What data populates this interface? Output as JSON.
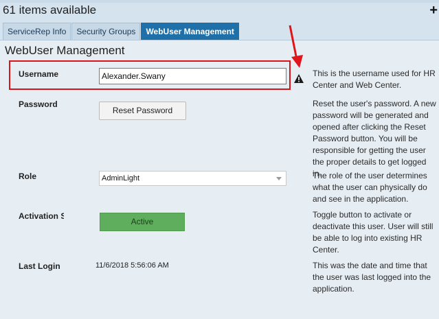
{
  "header": {
    "title": "61 items available",
    "add_icon": "plus-icon"
  },
  "tabs": [
    {
      "label": "ServiceRep Info",
      "active": false
    },
    {
      "label": "Security Groups",
      "active": false
    },
    {
      "label": "WebUser Management",
      "active": true
    }
  ],
  "section": {
    "title": "WebUser Management"
  },
  "fields": {
    "username": {
      "label": "Username",
      "value": "Alexander.Swany",
      "help": "This is the username used for HR Center and Web Center.",
      "warning_icon": "warning-icon"
    },
    "password": {
      "label": "Password",
      "button_label": "Reset Password",
      "help": "Reset the user's password. A new password will be generated and opened after clicking the Reset Password button. You will be responsible for getting the user the proper details to get logged in."
    },
    "role": {
      "label": "Role",
      "selected": "AdminLight",
      "help": "The role of the user determines what the user can physically do and see in the application."
    },
    "activation": {
      "label": "Activation Status",
      "button_label": "Active",
      "help": "Toggle button to activate or deactivate this user. User will still be able to log into existing HR Center."
    },
    "last_login": {
      "label": "Last Login",
      "value": "11/6/2018 5:56:06 AM",
      "help": "This was the date and time that the user was last logged into the application."
    }
  },
  "colors": {
    "active_tab": "#1f6fa8",
    "highlight_border": "#d7141a",
    "active_button": "#5fae5d"
  }
}
